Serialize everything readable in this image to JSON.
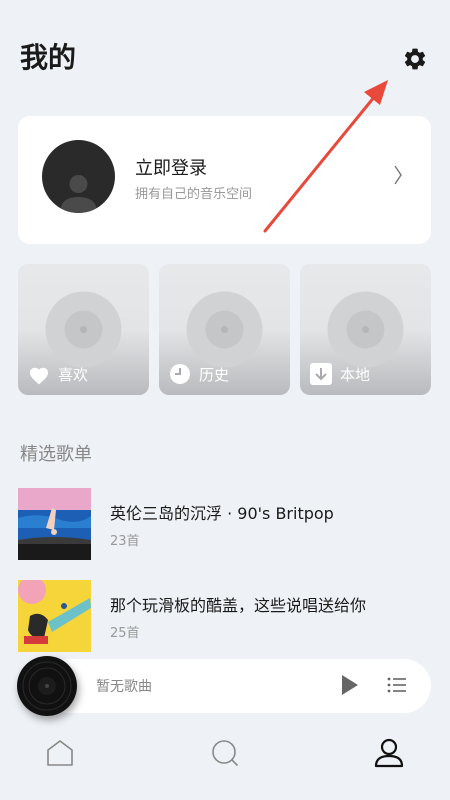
{
  "header": {
    "title": "我的",
    "settings_icon": "gear-icon"
  },
  "login": {
    "title": "立即登录",
    "subtitle": "拥有自己的音乐空间",
    "chevron": "〉"
  },
  "tiles": [
    {
      "label": "喜欢",
      "icon": "heart-icon"
    },
    {
      "label": "历史",
      "icon": "clock-icon"
    },
    {
      "label": "本地",
      "icon": "download-icon"
    }
  ],
  "section": {
    "title": "精选歌单"
  },
  "playlists": [
    {
      "name": "英伦三岛的沉浮 · 90's Britpop",
      "count": "23首"
    },
    {
      "name": "那个玩滑板的酷盖，这些说唱送给你",
      "count": "25首"
    }
  ],
  "player": {
    "now_playing": "暂无歌曲",
    "play_icon": "play-icon",
    "queue_icon": "playlist-queue-icon"
  },
  "tabbar": {
    "tabs": [
      "home-icon",
      "search-icon",
      "profile-icon"
    ],
    "active": "profile-icon"
  },
  "colors": {
    "accent_arrow": "#e8493a",
    "background": "#eef1f5"
  }
}
